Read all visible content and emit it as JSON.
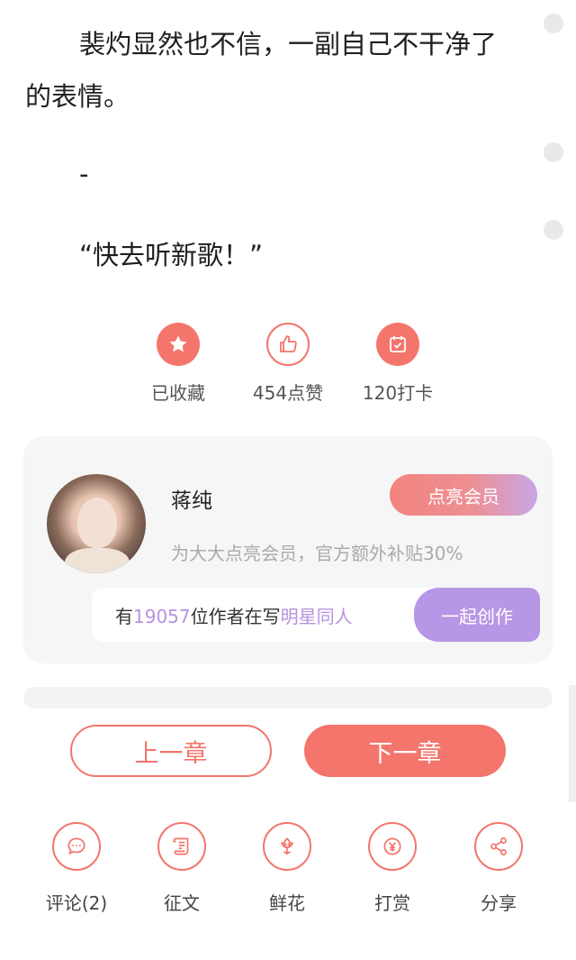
{
  "story": {
    "line1": "裴灼显然也不信，一副自己不干净了",
    "line2": "的表情。",
    "line3": "-",
    "line4": "“快去听新歌！”"
  },
  "actions": [
    {
      "label": "已收藏",
      "icon": "star-icon"
    },
    {
      "label": "454点赞",
      "icon": "thumbs-up-icon"
    },
    {
      "label": "120打卡",
      "icon": "calendar-check-icon"
    }
  ],
  "author_card": {
    "name": "蒋纯",
    "vip_button": "点亮会员",
    "vip_desc": "为大大点亮会员，官方额外补贴30%",
    "writers_prefix": "有",
    "writers_count": "19057",
    "writers_middle": "位作者在写",
    "writers_topic": "明星同人",
    "create_button": "一起创作"
  },
  "chapter_nav": {
    "prev": "上一章",
    "next": "下一章"
  },
  "toolbar": [
    {
      "label": "评论(2)",
      "icon": "comment-icon"
    },
    {
      "label": "征文",
      "icon": "scroll-icon"
    },
    {
      "label": "鲜花",
      "icon": "flower-icon"
    },
    {
      "label": "打赏",
      "icon": "yen-coin-icon"
    },
    {
      "label": "分享",
      "icon": "share-icon"
    }
  ],
  "colors": {
    "accent": "#f3756c",
    "purple": "#b896e6"
  }
}
